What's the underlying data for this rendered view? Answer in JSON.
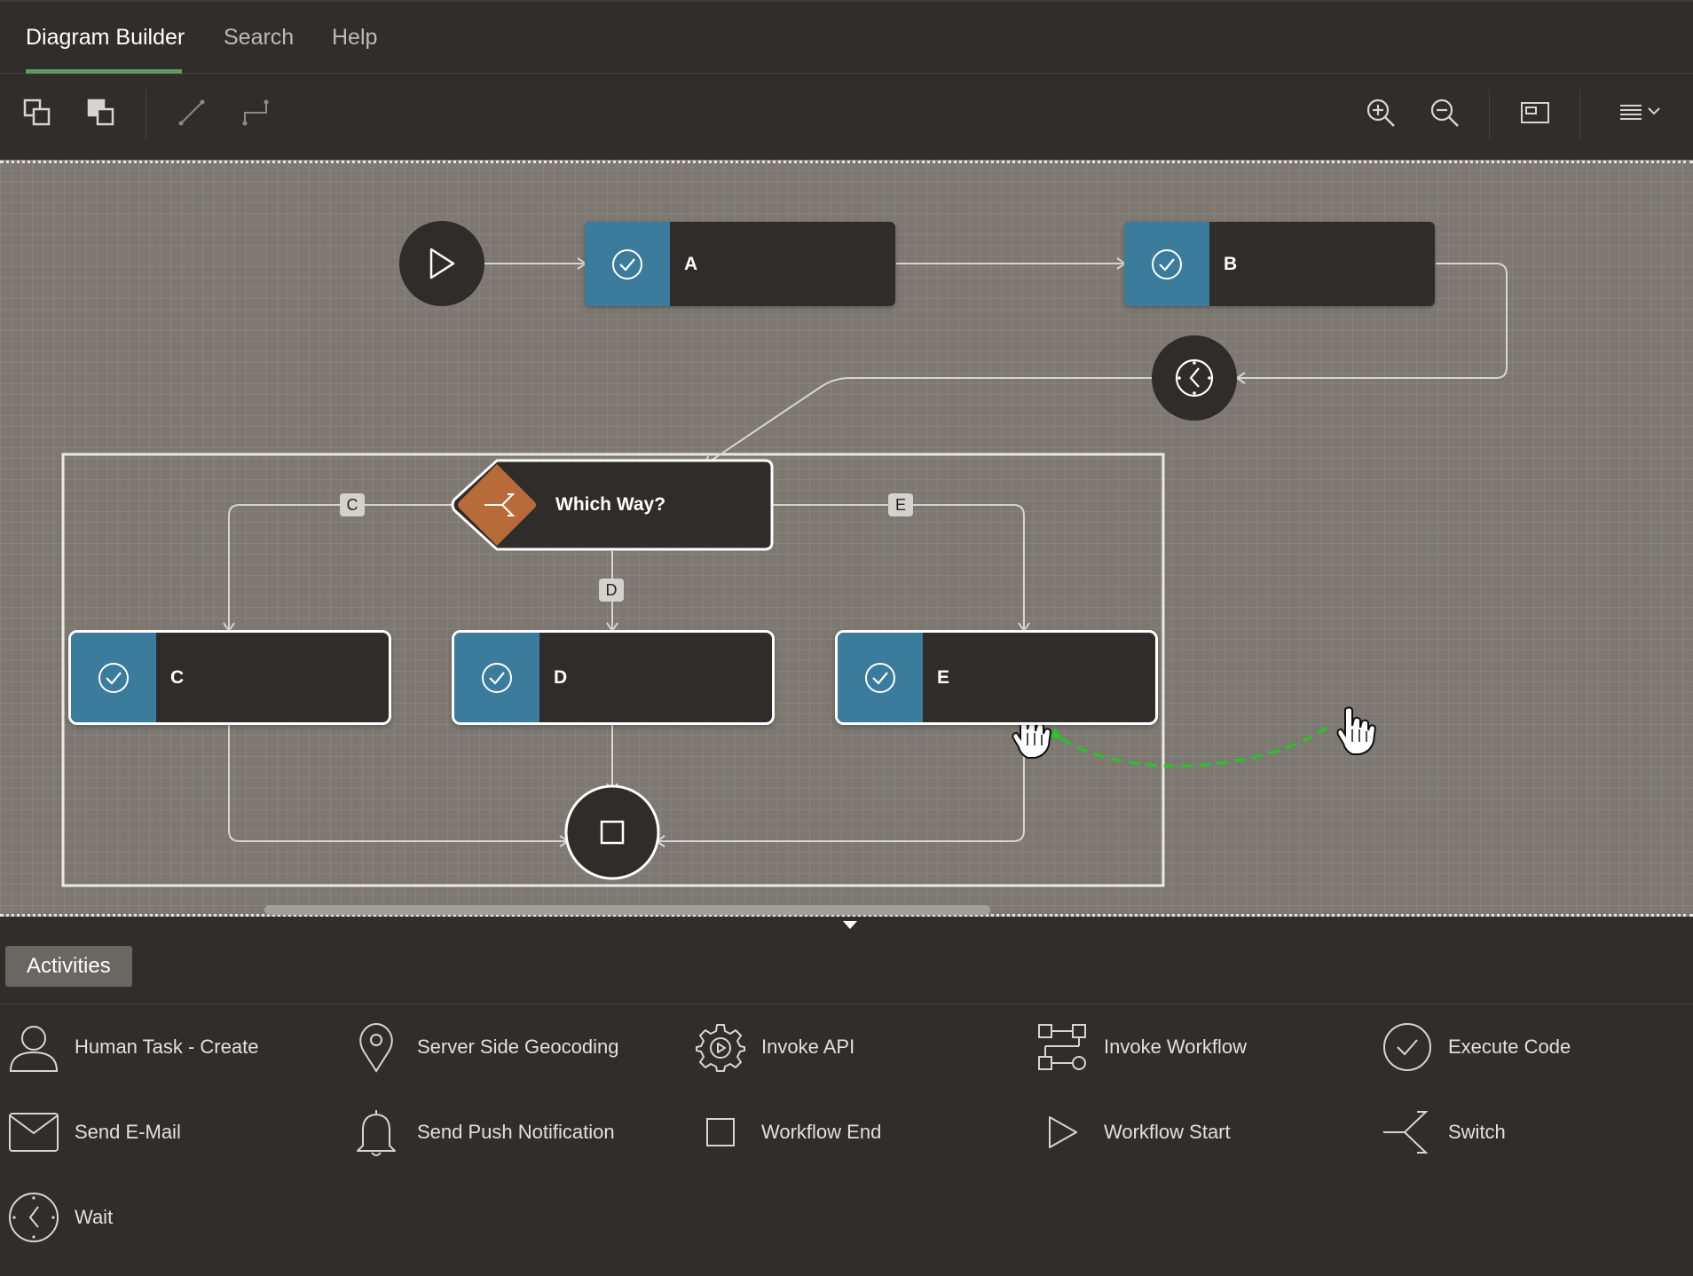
{
  "tabs": {
    "diagram_builder": "Diagram Builder",
    "search": "Search",
    "help": "Help"
  },
  "colors": {
    "accent_green": "#5e9a63",
    "task_blue": "#3b7b9c",
    "switch_orange": "#b86b38",
    "canvas": "#7d7872",
    "panel": "#302d2b",
    "drag_path": "#1fcc1f"
  },
  "toolbar": {
    "left_icons": [
      "bring-to-front-icon",
      "send-to-back-icon",
      "straight-connector-icon",
      "elbow-connector-icon"
    ],
    "right_icons": [
      "zoom-in-icon",
      "zoom-out-icon",
      "fit-to-screen-icon",
      "menu-icon"
    ]
  },
  "diagram": {
    "tasks": {
      "a": "A",
      "b": "B",
      "c": "C",
      "d": "D",
      "e": "E"
    },
    "switch_label": "Which Way?",
    "branch_labels": {
      "c": "C",
      "d": "D",
      "e": "E"
    },
    "start_icon": "play-icon",
    "wait_icon": "clock-icon",
    "end_icon": "square-icon"
  },
  "activities": {
    "tab_label": "Activities",
    "items": [
      {
        "label": "Human Task - Create",
        "icon": "person-icon"
      },
      {
        "label": "Server Side Geocoding",
        "icon": "map-pin-icon"
      },
      {
        "label": "Invoke API",
        "icon": "gear-play-icon"
      },
      {
        "label": "Invoke Workflow",
        "icon": "workflow-icon"
      },
      {
        "label": "Execute Code",
        "icon": "check-circle-icon"
      },
      {
        "label": "Send E-Mail",
        "icon": "envelope-icon"
      },
      {
        "label": "Send Push Notification",
        "icon": "bell-icon"
      },
      {
        "label": "Workflow End",
        "icon": "square-icon"
      },
      {
        "label": "Workflow Start",
        "icon": "play-icon"
      },
      {
        "label": "Switch",
        "icon": "switch-icon"
      },
      {
        "label": "Wait",
        "icon": "clock-icon"
      }
    ]
  }
}
